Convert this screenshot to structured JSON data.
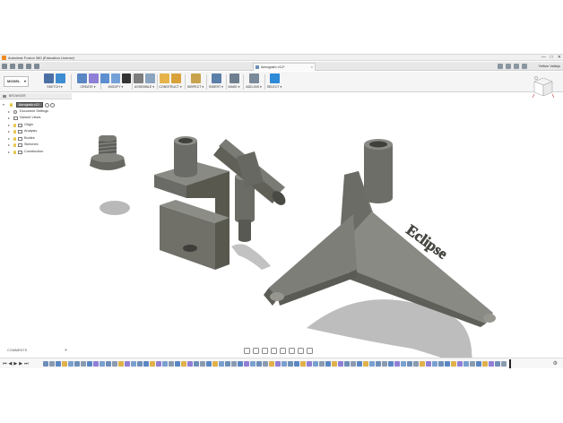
{
  "window": {
    "title": "Autodesk Fusion 360 (Education License)",
    "controls": [
      "—",
      "□",
      "✕"
    ]
  },
  "tabs": {
    "document_title": "Aerografo v12*",
    "close_glyph": "×",
    "user_name": "Yeltsin Vallejo"
  },
  "toolbar": {
    "workspace": "MODEL",
    "workspace_caret": "▾",
    "groups": [
      {
        "label": "SKETCH ▾",
        "icons": [
          "sketch-icon",
          "line-icon"
        ],
        "colors": [
          "#4a6fa5",
          "#3f8dd1"
        ]
      },
      {
        "label": "CREATE ▾",
        "icons": [
          "box-icon",
          "extrude-icon"
        ],
        "colors": [
          "#5a86c4",
          "#8f7fd6"
        ]
      },
      {
        "label": "MODIFY ▾",
        "icons": [
          "press-pull-icon",
          "fillet-icon",
          "sum-icon"
        ],
        "colors": [
          "#5c8ed0",
          "#74a0d8",
          "#333333"
        ]
      },
      {
        "label": "ASSEMBLE ▾",
        "icons": [
          "new-component-icon",
          "joint-icon"
        ],
        "colors": [
          "#7d7d7d",
          "#8aa3be"
        ]
      },
      {
        "label": "CONSTRUCT ▾",
        "icons": [
          "plane-icon",
          "axis-icon"
        ],
        "colors": [
          "#e6b34a",
          "#d9a13a"
        ]
      },
      {
        "label": "INSPECT ▾",
        "icons": [
          "measure-icon"
        ],
        "colors": [
          "#c8a24d"
        ]
      },
      {
        "label": "INSERT ▾",
        "icons": [
          "insert-image-icon"
        ],
        "colors": [
          "#5a7fa8"
        ]
      },
      {
        "label": "MAKE ▾",
        "icons": [
          "3d-print-icon"
        ],
        "colors": [
          "#6f7f8f"
        ]
      },
      {
        "label": "ADD-INS ▾",
        "icons": [
          "scripts-icon"
        ],
        "colors": [
          "#7a8a9a"
        ]
      },
      {
        "label": "SELECT ▾",
        "icons": [
          "select-icon"
        ],
        "colors": [
          "#2d8ad6"
        ]
      }
    ]
  },
  "browser": {
    "header": "BROWSER",
    "root": "Aerografo v12",
    "items": [
      {
        "label": "Document Settings",
        "kind": "gear"
      },
      {
        "label": "Named Views",
        "kind": "folder"
      },
      {
        "label": "Origin",
        "kind": "bulb-folder"
      },
      {
        "label": "Analysis",
        "kind": "bulb-folder"
      },
      {
        "label": "Bodies",
        "kind": "bulb-folder"
      },
      {
        "label": "Sketches",
        "kind": "bulb-folder"
      },
      {
        "label": "Construction",
        "kind": "bulb-folder"
      }
    ]
  },
  "model": {
    "base_engraving": "Eclipse"
  },
  "comments": {
    "label": "COMMENTS",
    "plus": "+"
  },
  "timeline": {
    "controls": [
      "⏮",
      "◀",
      "▶",
      "▶",
      "⏭"
    ],
    "settings_glyph": "⚙"
  },
  "colors": {
    "part_gray": "#6b6b66",
    "shadow": "#b9b9b9",
    "accent": "#0696d7"
  }
}
